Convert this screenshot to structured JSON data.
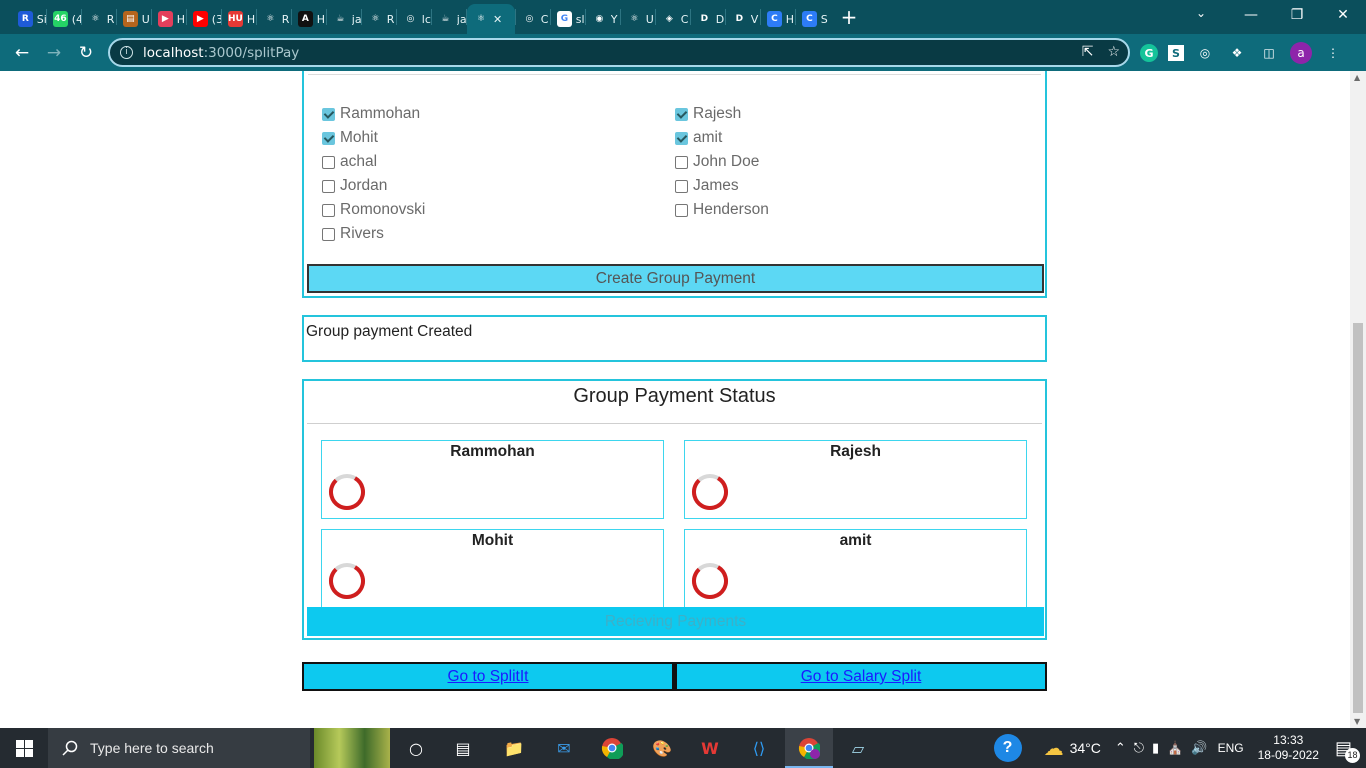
{
  "browser": {
    "tabs": [
      {
        "letter": "R",
        "label": "Si",
        "color": "#1e5bd8"
      },
      {
        "letter": "46",
        "label": "(4",
        "color": "#25d366"
      },
      {
        "letter": "⚛",
        "label": "R",
        "color": "#0b4f5c"
      },
      {
        "letter": "▤",
        "label": "U",
        "color": "#b5651d"
      },
      {
        "letter": "▶",
        "label": "H",
        "color": "#e33f5c"
      },
      {
        "letter": "▶",
        "label": "(3",
        "color": "#ff0000"
      },
      {
        "letter": "HU",
        "label": "H",
        "color": "#e53935"
      },
      {
        "letter": "⚛",
        "label": "R",
        "color": "#0b4f5c"
      },
      {
        "letter": "A",
        "label": "H",
        "color": "#111111"
      },
      {
        "letter": "☕",
        "label": "ja",
        "color": "#0b4f5c"
      },
      {
        "letter": "⚛",
        "label": "R",
        "color": "#0b4f5c"
      },
      {
        "letter": "◎",
        "label": "lc",
        "color": "#0b4f5c"
      },
      {
        "letter": "☕",
        "label": "ja",
        "color": "#0b4f5c"
      },
      {
        "letter": "⚛",
        "label": "✕",
        "color": "#0e6b7b"
      },
      {
        "letter": "◎",
        "label": "C",
        "color": "#0b4f5c"
      },
      {
        "letter": "G",
        "label": "sl",
        "color": "#ffffff"
      },
      {
        "letter": "◉",
        "label": "Y",
        "color": "#0b4f5c"
      },
      {
        "letter": "⚛",
        "label": "U",
        "color": "#0b4f5c"
      },
      {
        "letter": "◈",
        "label": "C",
        "color": "#0b4f5c"
      },
      {
        "letter": "D",
        "label": "D",
        "color": "#0b4f5c"
      },
      {
        "letter": "D",
        "label": "V",
        "color": "#0b4f5c"
      },
      {
        "letter": "C",
        "label": "H",
        "color": "#2d7cf6"
      },
      {
        "letter": "C",
        "label": "S",
        "color": "#2d7cf6"
      }
    ],
    "new_tab": "+",
    "url_host": "localhost",
    "url_path": ":3000/splitPay",
    "avatar_letter": "a",
    "window_controls": {
      "minimize": "—",
      "restore": "❐",
      "close": "✕"
    }
  },
  "members": {
    "left": [
      {
        "name": "Rammohan",
        "checked": true
      },
      {
        "name": "Mohit",
        "checked": true
      },
      {
        "name": "achal",
        "checked": false
      },
      {
        "name": "Jordan",
        "checked": false
      },
      {
        "name": "Romonovski",
        "checked": false
      },
      {
        "name": "Rivers",
        "checked": false
      }
    ],
    "right": [
      {
        "name": "Rajesh",
        "checked": true
      },
      {
        "name": "amit",
        "checked": true
      },
      {
        "name": "John Doe",
        "checked": false
      },
      {
        "name": "James",
        "checked": false
      },
      {
        "name": "Henderson",
        "checked": false
      }
    ],
    "create_label": "Create Group Payment"
  },
  "message": "Group payment Created",
  "status": {
    "title": "Group Payment Status",
    "payers": [
      "Rammohan",
      "Rajesh",
      "Mohit",
      "amit"
    ],
    "receiving_label": "Recieving Payments"
  },
  "links": {
    "splitit": "Go to SplitIt",
    "salary": "Go to Salary Split"
  },
  "taskbar": {
    "search_placeholder": "Type here to search",
    "temperature": "34°C",
    "language": "ENG",
    "time": "13:33",
    "date": "18-09-2022",
    "notifications": "18"
  }
}
